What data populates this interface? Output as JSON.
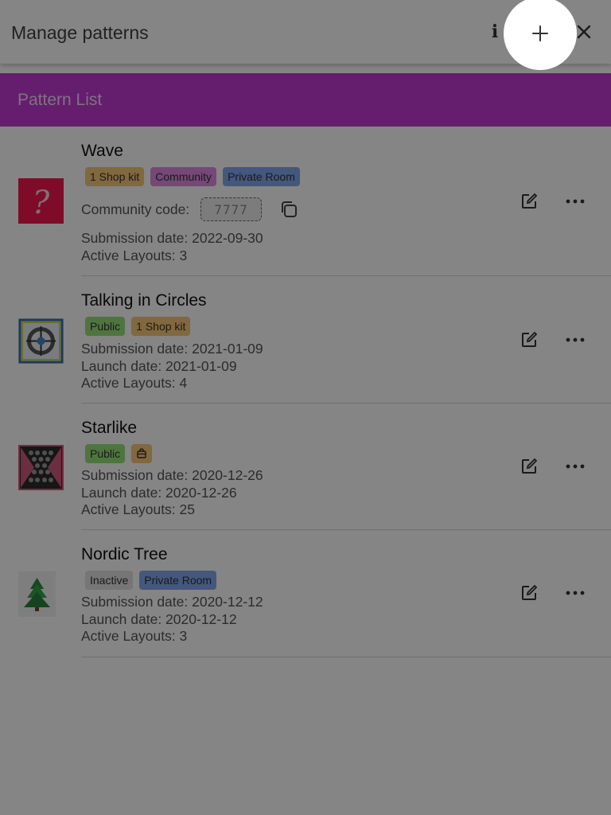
{
  "header": {
    "title": "Manage patterns",
    "info_icon": "info-icon",
    "add_icon": "plus-icon",
    "close_icon": "close-icon"
  },
  "section": {
    "title": "Pattern List"
  },
  "colors": {
    "accent": "#c13ad4",
    "tag_shop": "#f7c778",
    "tag_community": "#e08ae6",
    "tag_private": "#83a8f0",
    "tag_public": "#97e17a",
    "tag_inactive": "#e2e2e2"
  },
  "patterns": [
    {
      "name": "Wave",
      "tags": [
        "1 Shop kit",
        "Community",
        "Private Room"
      ],
      "community_code_label": "Community code:",
      "community_code": "7777",
      "submission": "Submission date: 2022-09-30",
      "active_layouts": "Active Layouts: 3",
      "thumbnail": "question-mark-thumbnail"
    },
    {
      "name": "Talking in Circles",
      "tags": [
        "Public",
        "1 Shop kit"
      ],
      "submission": "Submission date: 2021-01-09",
      "launch": "Launch date: 2021-01-09",
      "active_layouts": "Active Layouts: 4",
      "thumbnail": "circles-thumbnail"
    },
    {
      "name": "Starlike",
      "tags": [
        "Public"
      ],
      "tag_icon": "shopping-bag-icon",
      "submission": "Submission date: 2020-12-26",
      "launch": "Launch date: 2020-12-26",
      "active_layouts": "Active Layouts: 25",
      "thumbnail": "starlike-thumbnail"
    },
    {
      "name": "Nordic Tree",
      "tags": [
        "Inactive",
        "Private Room"
      ],
      "submission": "Submission date: 2020-12-12",
      "launch": "Launch date: 2020-12-12",
      "active_layouts": "Active Layouts: 3",
      "thumbnail": "tree-thumbnail"
    }
  ]
}
